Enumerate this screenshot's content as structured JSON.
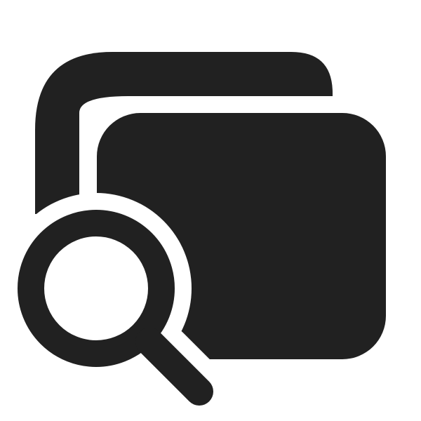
{
  "icon": {
    "name": "copy-search-icon",
    "description_parts": [
      "back-document-icon",
      "front-document-icon",
      "magnifier-icon"
    ]
  },
  "colors": {
    "background": "#ffffff",
    "foreground": "#212121"
  }
}
